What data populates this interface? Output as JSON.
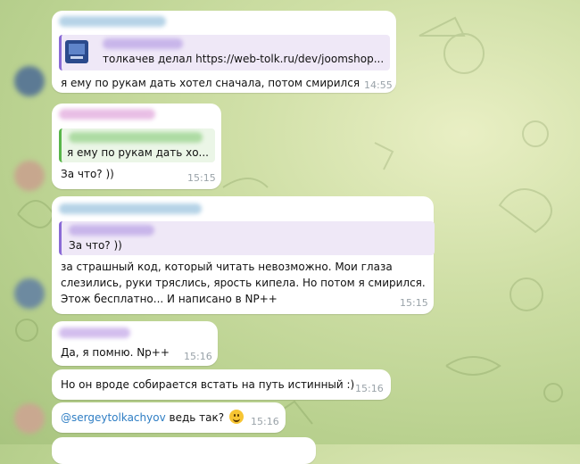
{
  "colors": {
    "bubble": "#ffffff",
    "reply_purple": "#8a6ad6",
    "reply_green": "#59b64a",
    "mention": "#2f7ec4",
    "time": "#9aa3a9"
  },
  "messages": [
    {
      "reply_text": "толкачев делал https://web-tolk.ru/dev/joomshop...",
      "text": "я ему по рукам дать хотел сначала, потом смирился",
      "time": "14:55"
    },
    {
      "reply_text": "я ему по рукам дать хо...",
      "text": "За что? ))",
      "time": "15:15"
    },
    {
      "reply_text": "За что? ))",
      "lines": [
        "за страшный код, который читать невозможно. Мои глаза",
        "слезились, руки тряслись, ярость кипела. Но потом я смирился.",
        "Этож бесплатно... И написано в NP++"
      ],
      "time": "15:15"
    },
    {
      "text": "Да, я помню. Np++",
      "time": "15:16"
    },
    {
      "text": "Но он вроде собирается встать на путь истинный :)",
      "time": "15:16"
    },
    {
      "mention": "@sergeytolkachyov",
      "text": " ведь так? ",
      "emoji": "smiling-face",
      "time": "15:16"
    }
  ]
}
